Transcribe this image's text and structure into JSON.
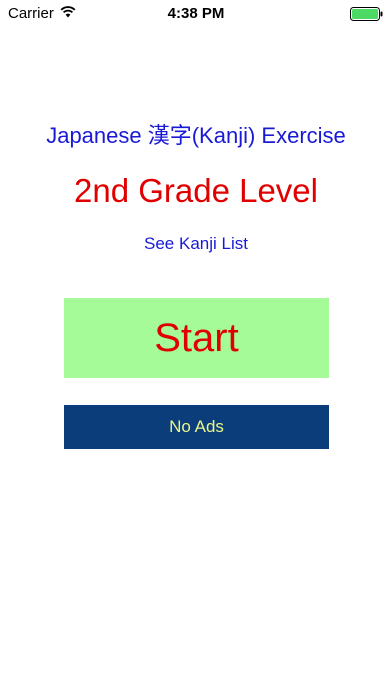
{
  "status_bar": {
    "carrier": "Carrier",
    "time": "4:38 PM",
    "wifi_icon": "wifi-icon",
    "battery_icon": "battery-full-icon",
    "battery_color": "#4cd964"
  },
  "main": {
    "title": "Japanese 漢字(Kanji) Exercise",
    "level": "2nd Grade Level",
    "kanji_list_link": "See Kanji List",
    "start_button": "Start",
    "no_ads_button": "No Ads"
  },
  "colors": {
    "title_blue": "#1a1ad6",
    "level_red": "#e00000",
    "start_bg": "#a6fb99",
    "no_ads_bg": "#0b3d7a",
    "no_ads_text": "#e9f58a"
  }
}
